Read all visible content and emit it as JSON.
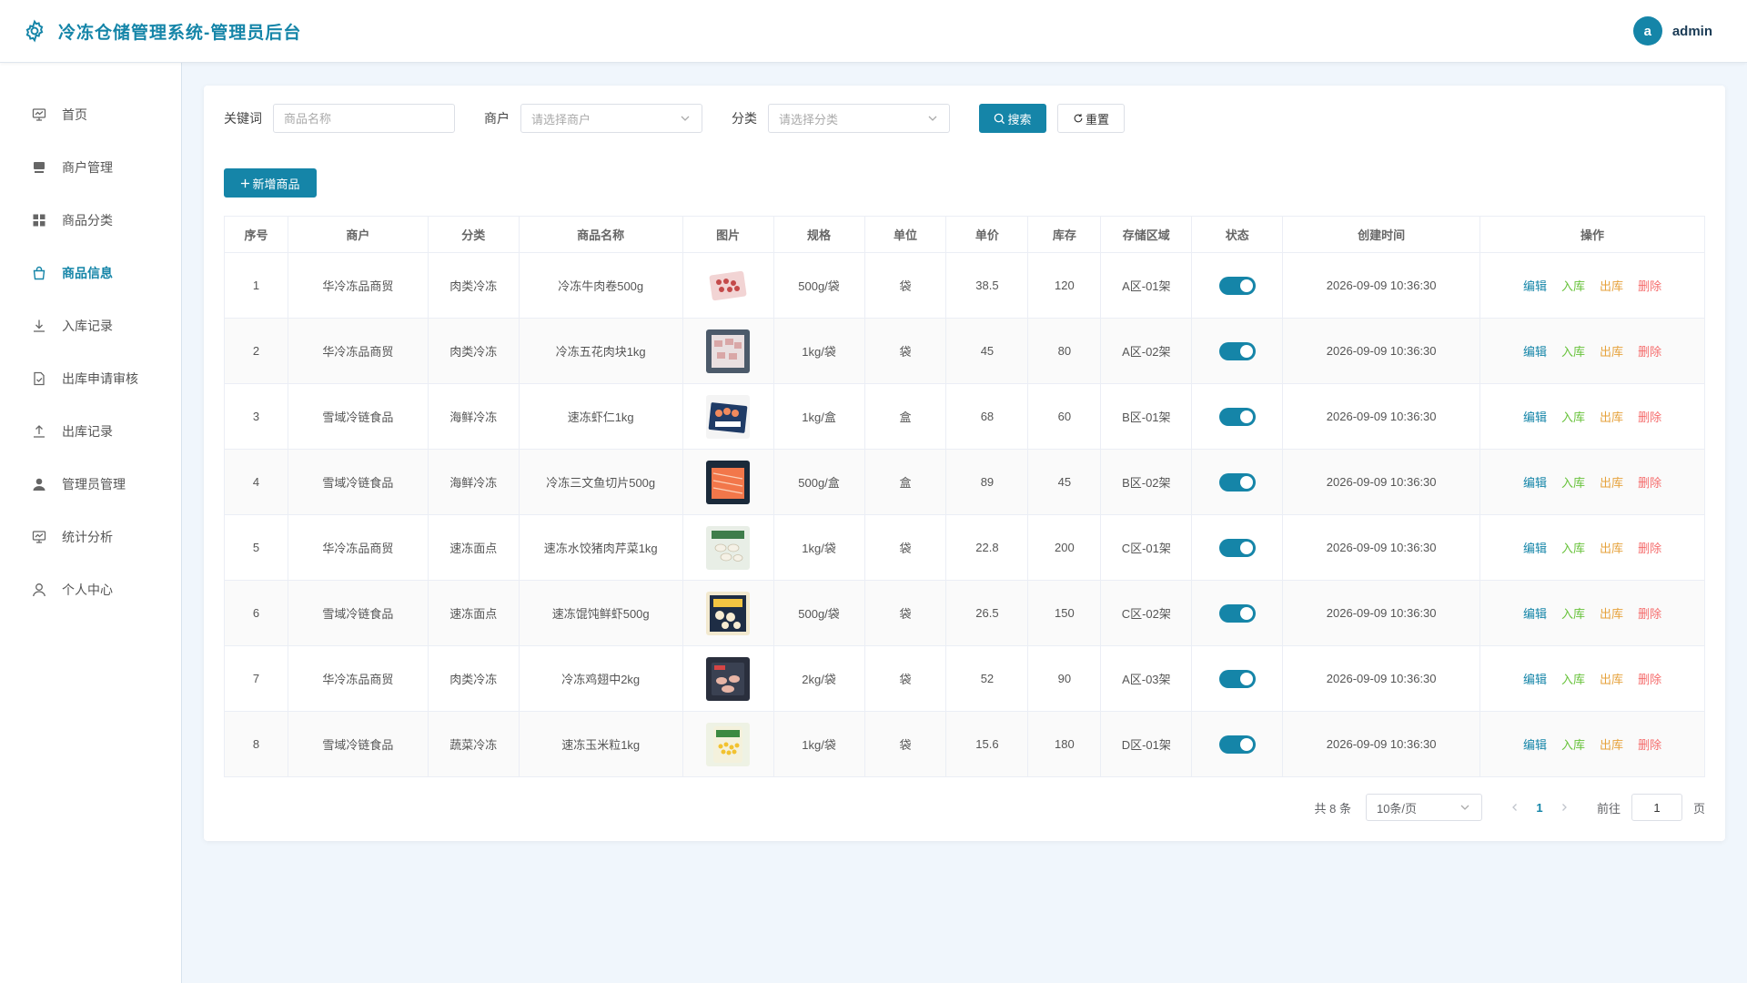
{
  "header": {
    "title": "冷冻仓储管理系统-管理员后台",
    "avatar_letter": "a",
    "username": "admin"
  },
  "sidebar": {
    "items": [
      {
        "label": "首页",
        "icon": "monitor-icon"
      },
      {
        "label": "商户管理",
        "icon": "store-icon"
      },
      {
        "label": "商品分类",
        "icon": "grid-icon"
      },
      {
        "label": "商品信息",
        "icon": "bag-icon",
        "active": true
      },
      {
        "label": "入库记录",
        "icon": "download-icon"
      },
      {
        "label": "出库申请审核",
        "icon": "doc-check-icon"
      },
      {
        "label": "出库记录",
        "icon": "upload-icon"
      },
      {
        "label": "管理员管理",
        "icon": "user-filled-icon"
      },
      {
        "label": "统计分析",
        "icon": "chart-icon"
      },
      {
        "label": "个人中心",
        "icon": "user-icon"
      }
    ]
  },
  "filters": {
    "keyword_label": "关键词",
    "keyword_placeholder": "商品名称",
    "merchant_label": "商户",
    "merchant_placeholder": "请选择商户",
    "category_label": "分类",
    "category_placeholder": "请选择分类",
    "search_label": "搜索",
    "reset_label": "重置"
  },
  "add_button": "新增商品",
  "table": {
    "columns": [
      "序号",
      "商户",
      "分类",
      "商品名称",
      "图片",
      "规格",
      "单位",
      "单价",
      "库存",
      "存储区域",
      "状态",
      "创建时间",
      "操作"
    ],
    "rows": [
      {
        "no": "1",
        "merchant": "华冷冻品商贸",
        "category": "肉类冷冻",
        "name": "冷冻牛肉卷500g",
        "spec": "500g/袋",
        "unit": "袋",
        "price": "38.5",
        "stock": "120",
        "area": "A区-01架",
        "status_on": true,
        "created": "2026-09-09 10:36:30"
      },
      {
        "no": "2",
        "merchant": "华冷冻品商贸",
        "category": "肉类冷冻",
        "name": "冷冻五花肉块1kg",
        "spec": "1kg/袋",
        "unit": "袋",
        "price": "45",
        "stock": "80",
        "area": "A区-02架",
        "status_on": true,
        "created": "2026-09-09 10:36:30"
      },
      {
        "no": "3",
        "merchant": "雪域冷链食品",
        "category": "海鲜冷冻",
        "name": "速冻虾仁1kg",
        "spec": "1kg/盒",
        "unit": "盒",
        "price": "68",
        "stock": "60",
        "area": "B区-01架",
        "status_on": true,
        "created": "2026-09-09 10:36:30"
      },
      {
        "no": "4",
        "merchant": "雪域冷链食品",
        "category": "海鲜冷冻",
        "name": "冷冻三文鱼切片500g",
        "spec": "500g/盒",
        "unit": "盒",
        "price": "89",
        "stock": "45",
        "area": "B区-02架",
        "status_on": true,
        "created": "2026-09-09 10:36:30"
      },
      {
        "no": "5",
        "merchant": "华冷冻品商贸",
        "category": "速冻面点",
        "name": "速冻水饺猪肉芹菜1kg",
        "spec": "1kg/袋",
        "unit": "袋",
        "price": "22.8",
        "stock": "200",
        "area": "C区-01架",
        "status_on": true,
        "created": "2026-09-09 10:36:30"
      },
      {
        "no": "6",
        "merchant": "雪域冷链食品",
        "category": "速冻面点",
        "name": "速冻馄饨鲜虾500g",
        "spec": "500g/袋",
        "unit": "袋",
        "price": "26.5",
        "stock": "150",
        "area": "C区-02架",
        "status_on": true,
        "created": "2026-09-09 10:36:30"
      },
      {
        "no": "7",
        "merchant": "华冷冻品商贸",
        "category": "肉类冷冻",
        "name": "冷冻鸡翅中2kg",
        "spec": "2kg/袋",
        "unit": "袋",
        "price": "52",
        "stock": "90",
        "area": "A区-03架",
        "status_on": true,
        "created": "2026-09-09 10:36:30"
      },
      {
        "no": "8",
        "merchant": "雪域冷链食品",
        "category": "蔬菜冷冻",
        "name": "速冻玉米粒1kg",
        "spec": "1kg/袋",
        "unit": "袋",
        "price": "15.6",
        "stock": "180",
        "area": "D区-01架",
        "status_on": true,
        "created": "2026-09-09 10:36:30"
      }
    ],
    "actions": {
      "edit": "编辑",
      "stock_in": "入库",
      "stock_out": "出库",
      "delete": "删除"
    }
  },
  "pagination": {
    "total_text": "共 8 条",
    "page_size": "10条/页",
    "current_page": "1",
    "goto_label": "前往",
    "goto_value": "1",
    "page_suffix": "页"
  },
  "colors": {
    "primary": "#1585a8",
    "success": "#67c23a",
    "warning": "#e6a23c",
    "danger": "#f56c6c"
  }
}
